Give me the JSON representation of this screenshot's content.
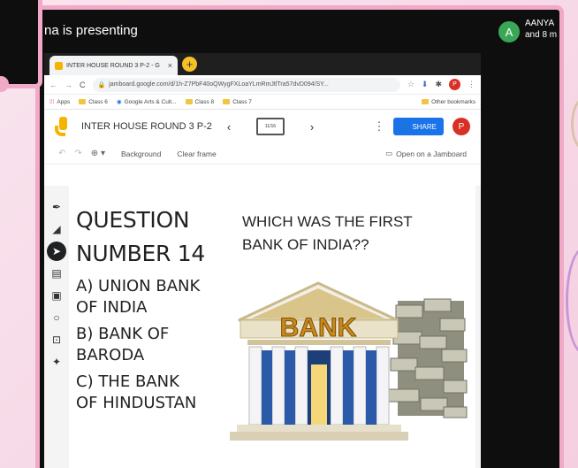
{
  "meeting": {
    "presenting_text": "na is presenting",
    "participant_initial": "A",
    "participant_name": "AANYA",
    "participant_more": "and 8 m"
  },
  "browser": {
    "tab_title": "INTER HOUSE ROUND 3 P-2 - G",
    "tab_close": "×",
    "new_tab": "+",
    "back": "←",
    "forward": "→",
    "reload": "C",
    "url": "jamboard.google.com/d/1h-Z7PbF40oQWygFXLoaYLmRmJtlTra57dvD094/SY...",
    "profile_initial": "P",
    "bookmarks": [
      "Apps",
      "Class 6",
      "Google Arts & Cult...",
      "Class 8",
      "Class 7"
    ],
    "other_bookmarks": "Other bookmarks"
  },
  "jamboard": {
    "title": "INTER HOUSE ROUND 3 P-2",
    "prev": "‹",
    "next": "›",
    "frame_counter": "11/16",
    "share_label": "SHARE",
    "profile_initial": "P",
    "zoom": "🔍",
    "background_label": "Background",
    "clear_frame_label": "Clear frame",
    "open_label": "Open on a Jamboard"
  },
  "frame": {
    "question_line1": "QUESTION",
    "question_line2": "NUMBER 14",
    "option_a1": "A) UNION BANK",
    "option_a2": "OF INDIA",
    "option_b1": "B) BANK OF",
    "option_b2": "BARODA",
    "option_c1": "C) THE BANK",
    "option_c2": "OF HINDUSTAN",
    "prompt_line1": "WHICH WAS THE FIRST",
    "prompt_line2": "BANK OF INDIA??",
    "bank_sign": "BANK"
  },
  "colors": {
    "frame_pink": "#f0a9c7",
    "share_blue": "#1a73e8",
    "profile_red": "#d93025",
    "jamboard_yellow": "#f6b400"
  }
}
